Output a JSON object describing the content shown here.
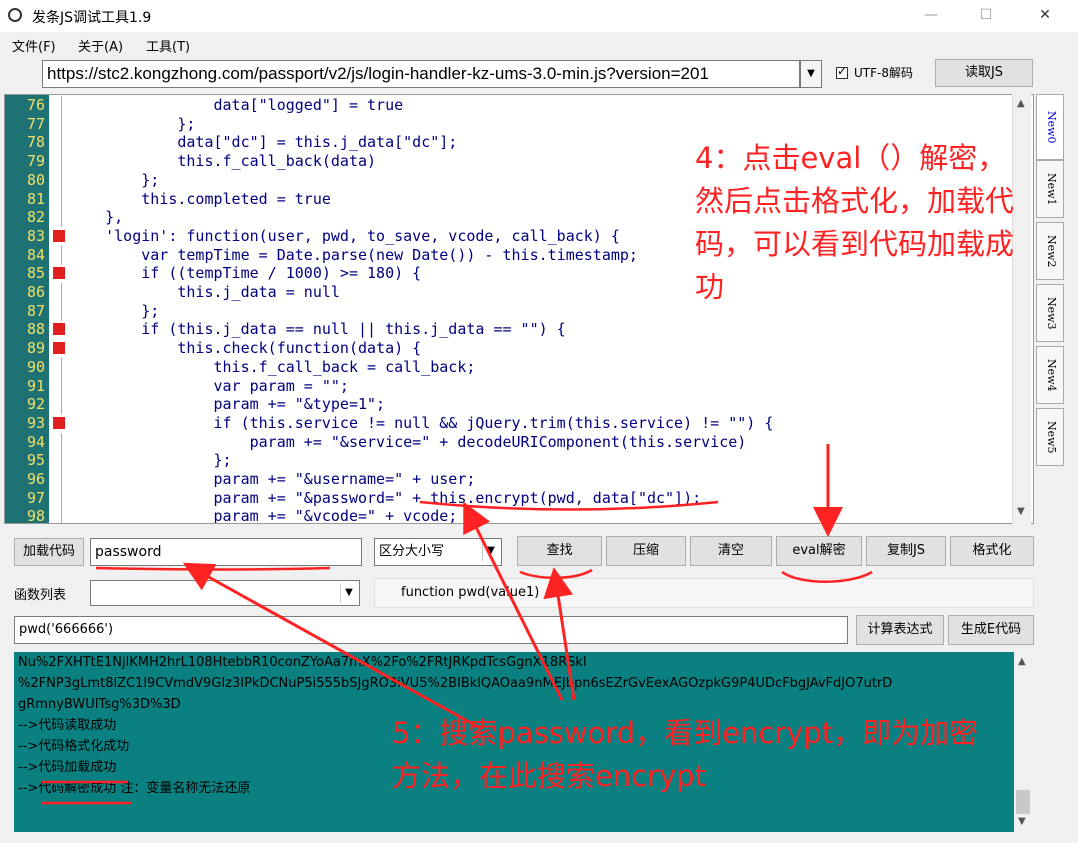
{
  "window": {
    "title": "发条JS调试工具1.9",
    "minimize": "—",
    "maximize": "☐",
    "close": "✕"
  },
  "menu": [
    "文件(F)",
    "关于(A)",
    "工具(T)"
  ],
  "url": {
    "value": "https://stc2.kongzhong.com/passport/v2/js/login-handler-kz-ums-3.0-min.js?version=201"
  },
  "utf8_label": "UTF-8解码",
  "read_js": "读取JS",
  "tabs": [
    "New0",
    "New1",
    "New2",
    "New3",
    "New4",
    "New5"
  ],
  "code_lines": [
    {
      "n": "76",
      "t": "                data[\"logged\"] = true"
    },
    {
      "n": "77",
      "t": "            };"
    },
    {
      "n": "78",
      "t": "            data[\"dc\"] = this.j_data[\"dc\"];"
    },
    {
      "n": "79",
      "t": "            this.f_call_back(data)"
    },
    {
      "n": "80",
      "t": "        };"
    },
    {
      "n": "81",
      "t": "        this.completed = true"
    },
    {
      "n": "82",
      "t": "    },"
    },
    {
      "n": "83",
      "t": "    'login': function(user, pwd, to_save, vcode, call_back) {"
    },
    {
      "n": "84",
      "t": "        var tempTime = Date.parse(new Date()) - this.timestamp;"
    },
    {
      "n": "85",
      "t": "        if ((tempTime / 1000) >= 180) {"
    },
    {
      "n": "86",
      "t": "            this.j_data = null"
    },
    {
      "n": "87",
      "t": "        };"
    },
    {
      "n": "88",
      "t": "        if (this.j_data == null || this.j_data == \"\") {"
    },
    {
      "n": "89",
      "t": "            this.check(function(data) {"
    },
    {
      "n": "90",
      "t": "                this.f_call_back = call_back;"
    },
    {
      "n": "91",
      "t": "                var param = \"\";"
    },
    {
      "n": "92",
      "t": "                param += \"&type=1\";"
    },
    {
      "n": "93",
      "t": "                if (this.service != null && jQuery.trim(this.service) != \"\") {"
    },
    {
      "n": "94",
      "t": "                    param += \"&service=\" + decodeURIComponent(this.service)"
    },
    {
      "n": "95",
      "t": "                };"
    },
    {
      "n": "96",
      "t": "                param += \"&username=\" + user;"
    },
    {
      "n": "97",
      "t": "                param += \"&password=\" + this.encrypt(pwd, data[\"dc\"]);"
    },
    {
      "n": "98",
      "t": "                param += \"&vcode=\" + vcode;"
    }
  ],
  "toolbar": {
    "load_code": "加载代码",
    "search_value": "password",
    "case_option": "区分大小写",
    "find": "查找",
    "compress": "压缩",
    "clear": "清空",
    "eval_decrypt": "eval解密",
    "copy_js": "复制JS",
    "format": "格式化"
  },
  "function_list": {
    "label": "函数列表",
    "value": "",
    "signature": "function pwd(value1)"
  },
  "expression": {
    "value": "pwd('666666')",
    "calc": "计算表达式",
    "gen_e": "生成E代码"
  },
  "output_lines": [
    "Nu%2FXHTtE1NjlKMH2hrL108HtebbR10conZYoAa7mX%2Fo%2FRtJRKpdTcsGgnX18RSkI",
    "%2FNP3gLmt8lZC1l9CVmdV9GIz3IPkDCNuP5i555bSJgRO3iVU5%2BIBklQAOaa9nMEJbpn6sEZrGvEexAGOzpkG9P4UDcFbgJAvFdJO7utrD",
    "gRmnyBWUITsg%3D%3D",
    "-->代码读取成功",
    "-->代码格式化成功",
    "-->代码加载成功",
    "-->代码解密成功 注：变量名称无法还原"
  ],
  "annotations": {
    "step4": [
      "4：点击eval（）解密，",
      "然后点击格式化，加载代",
      "码，可以看到代码加载成",
      "功"
    ],
    "step5": [
      "5：搜索password，看到encrypt，即为加密",
      "方法，在此搜索encrypt"
    ]
  },
  "colors": {
    "gutter": "#1f7273",
    "output_bg": "#0a8080",
    "annotation": "#ff2222",
    "code_text": "#000080",
    "line_number": "#f0e06a"
  }
}
